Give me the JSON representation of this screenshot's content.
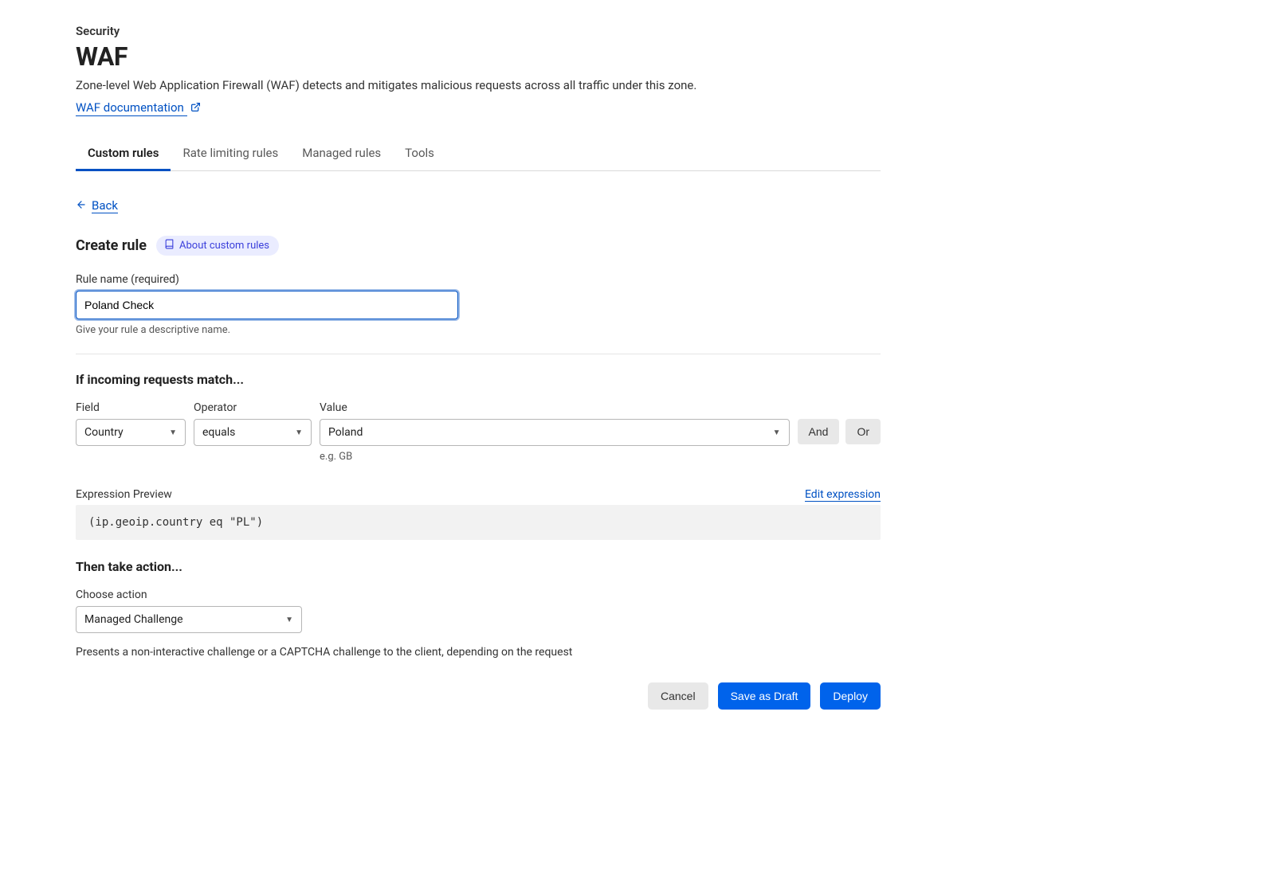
{
  "breadcrumb": "Security",
  "page_title": "WAF",
  "page_description": "Zone-level Web Application Firewall (WAF) detects and mitigates malicious requests across all traffic under this zone.",
  "doc_link": "WAF documentation",
  "tabs": {
    "custom_rules": "Custom rules",
    "rate_limiting": "Rate limiting rules",
    "managed_rules": "Managed rules",
    "tools": "Tools"
  },
  "back_label": "Back",
  "create_rule_title": "Create rule",
  "about_custom_rules": "About custom rules",
  "rule_name": {
    "label": "Rule name (required)",
    "value": "Poland Check",
    "helper": "Give your rule a descriptive name."
  },
  "match_section_title": "If incoming requests match...",
  "match_row": {
    "field_label": "Field",
    "operator_label": "Operator",
    "value_label": "Value",
    "field_value": "Country",
    "operator_value": "equals",
    "value_value": "Poland",
    "value_hint": "e.g. GB"
  },
  "and_label": "And",
  "or_label": "Or",
  "expression": {
    "label": "Expression Preview",
    "edit_label": "Edit expression",
    "code": "(ip.geoip.country eq \"PL\")"
  },
  "action_section_title": "Then take action...",
  "action": {
    "label": "Choose action",
    "value": "Managed Challenge",
    "description": "Presents a non-interactive challenge or a CAPTCHA challenge to the client, depending on the request"
  },
  "buttons": {
    "cancel": "Cancel",
    "save_draft": "Save as Draft",
    "deploy": "Deploy"
  }
}
